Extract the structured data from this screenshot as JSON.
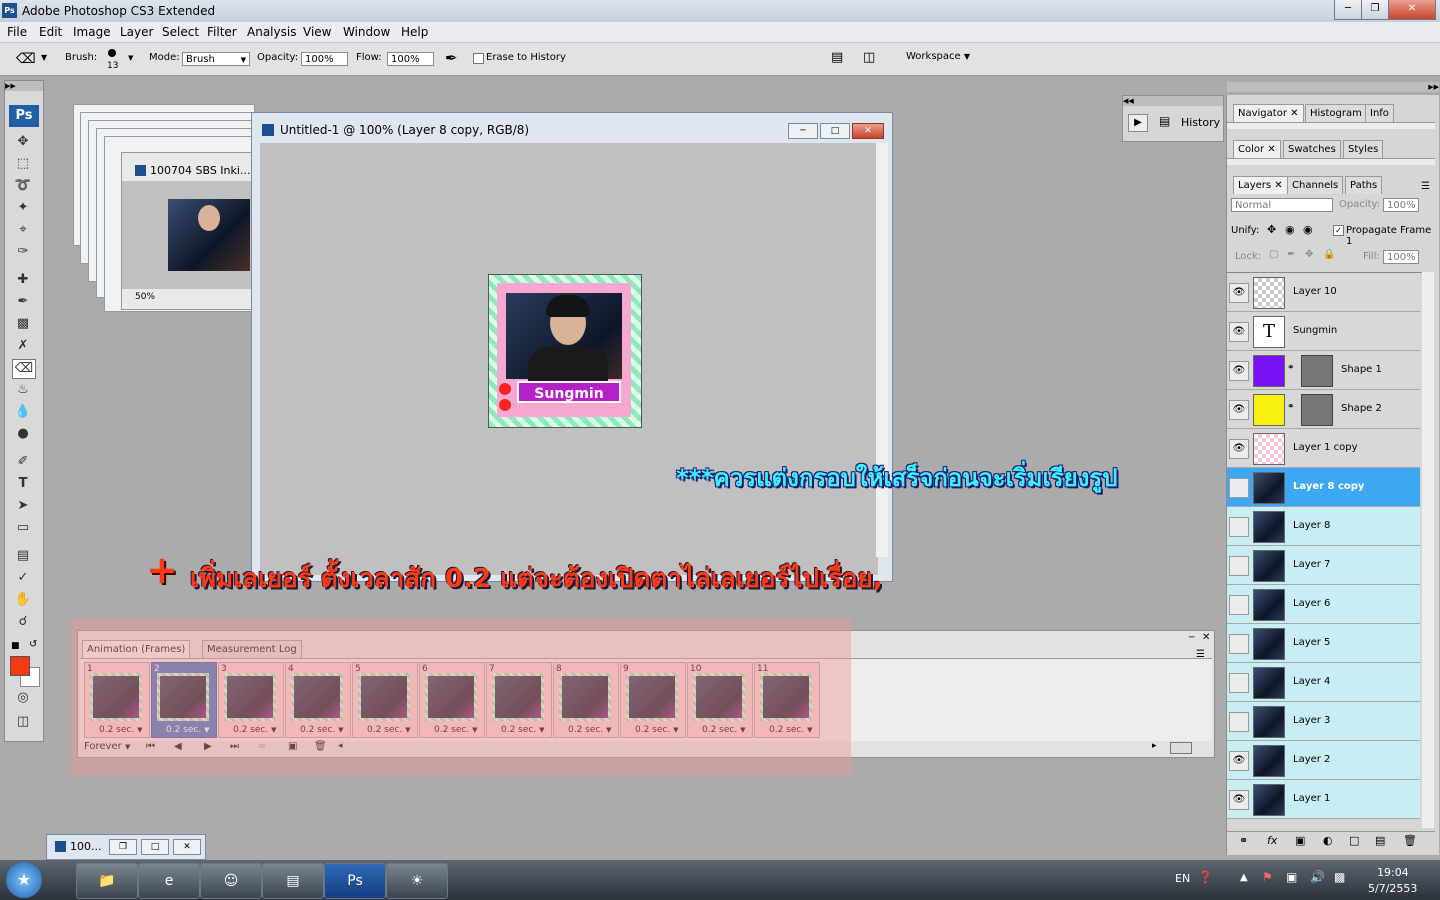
{
  "app": {
    "title": "Adobe Photoshop CS3 Extended"
  },
  "menu": [
    "File",
    "Edit",
    "Image",
    "Layer",
    "Select",
    "Filter",
    "Analysis",
    "View",
    "Window",
    "Help"
  ],
  "options": {
    "brush_label": "Brush:",
    "brush_size": "13",
    "mode_label": "Mode:",
    "mode_value": "Brush",
    "opacity_label": "Opacity:",
    "opacity_value": "100%",
    "flow_label": "Flow:",
    "flow_value": "100%",
    "erase_history_label": "Erase to History",
    "workspace_label": "Workspace"
  },
  "toolbox": {
    "logo": "Ps"
  },
  "docs": {
    "back_title": "100704 SBS Inki...",
    "back_zoom": "50%",
    "main_title": "Untitled-1 @ 100% (Layer 8 copy, RGB/8)",
    "art_name": "Sungmin"
  },
  "overlay": {
    "note1": "***ควรแต่งกรอบให้เสร็จก่อนจะเริ่มเรียงรูป",
    "plus": "+",
    "note2": "เพิ่มเลเยอร์ ตั้งเวลาสัก 0.2 แต่จะต้องเปิดตาไล่เลเยอร์ไปเรื่อย,"
  },
  "animation": {
    "tab_frames": "Animation (Frames)",
    "tab_log": "Measurement Log",
    "loop": "Forever",
    "frames": [
      {
        "n": "1",
        "delay": "0.2 sec."
      },
      {
        "n": "2",
        "delay": "0.2 sec."
      },
      {
        "n": "3",
        "delay": "0.2 sec."
      },
      {
        "n": "4",
        "delay": "0.2 sec."
      },
      {
        "n": "5",
        "delay": "0.2 sec."
      },
      {
        "n": "6",
        "delay": "0.2 sec."
      },
      {
        "n": "7",
        "delay": "0.2 sec."
      },
      {
        "n": "8",
        "delay": "0.2 sec."
      },
      {
        "n": "9",
        "delay": "0.2 sec."
      },
      {
        "n": "10",
        "delay": "0.2 sec."
      },
      {
        "n": "11",
        "delay": "0.2 sec."
      }
    ]
  },
  "history": {
    "label": "History"
  },
  "panels": {
    "nav_tabs": [
      "Navigator",
      "Histogram",
      "Info"
    ],
    "color_tabs": [
      "Color",
      "Swatches",
      "Styles"
    ],
    "layer_tabs": [
      "Layers",
      "Channels",
      "Paths"
    ],
    "blend_mode": "Normal",
    "opacity_label": "Opacity:",
    "opacity_value": "100%",
    "unify_label": "Unify:",
    "propagate_label": "Propagate Frame 1",
    "lock_label": "Lock:",
    "fill_label": "Fill:",
    "fill_value": "100%"
  },
  "layers": [
    {
      "name": "Layer 10"
    },
    {
      "name": "Sungmin"
    },
    {
      "name": "Shape 1"
    },
    {
      "name": "Shape 2"
    },
    {
      "name": "Layer 1 copy"
    },
    {
      "name": "Layer 8 copy"
    },
    {
      "name": "Layer 8"
    },
    {
      "name": "Layer 7"
    },
    {
      "name": "Layer 6"
    },
    {
      "name": "Layer 5"
    },
    {
      "name": "Layer 4"
    },
    {
      "name": "Layer 3"
    },
    {
      "name": "Layer 2"
    },
    {
      "name": "Layer 1"
    }
  ],
  "minimized": {
    "label": "100..."
  },
  "taskbar": {
    "lang": "EN",
    "time": "19:04",
    "date": "5/7/2553"
  }
}
